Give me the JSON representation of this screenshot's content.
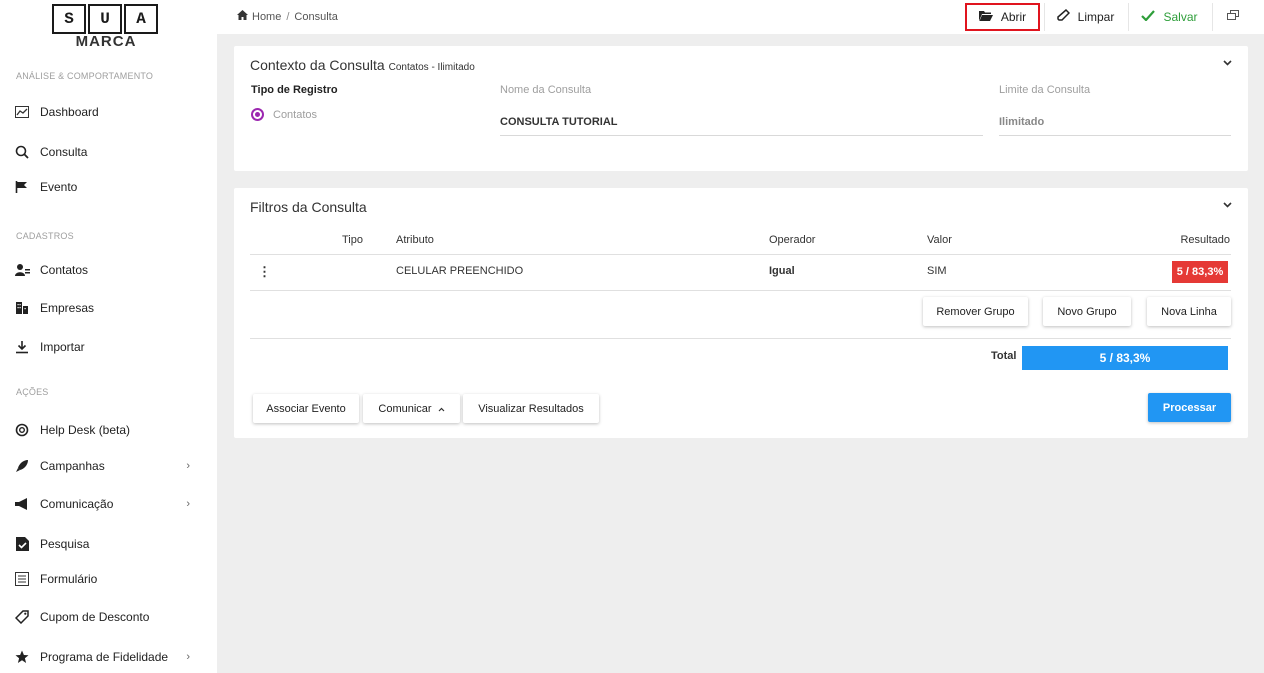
{
  "logo": {
    "letters": [
      "S",
      "U",
      "A"
    ],
    "subtitle": "MARCA"
  },
  "sidebar": {
    "sections": [
      {
        "title": "ANÁLISE & COMPORTAMENTO",
        "items": [
          {
            "label": "Dashboard",
            "icon": "dashboard-chart-icon"
          },
          {
            "label": "Consulta",
            "icon": "search-icon"
          },
          {
            "label": "Evento",
            "icon": "flag-icon"
          }
        ]
      },
      {
        "title": "CADASTROS",
        "items": [
          {
            "label": "Contatos",
            "icon": "contacts-icon"
          },
          {
            "label": "Empresas",
            "icon": "building-icon"
          },
          {
            "label": "Importar",
            "icon": "download-icon"
          }
        ]
      },
      {
        "title": "AÇÕES",
        "items": [
          {
            "label": "Help Desk (beta)",
            "icon": "lifebuoy-icon"
          },
          {
            "label": "Campanhas",
            "icon": "rocket-icon",
            "expandable": true
          },
          {
            "label": "Comunicação",
            "icon": "megaphone-icon",
            "expandable": true
          },
          {
            "label": "Pesquisa",
            "icon": "survey-check-icon"
          },
          {
            "label": "Formulário",
            "icon": "form-icon"
          },
          {
            "label": "Cupom de Desconto",
            "icon": "coupon-tag-icon"
          },
          {
            "label": "Programa de Fidelidade",
            "icon": "star-icon",
            "expandable": true
          }
        ]
      }
    ]
  },
  "breadcrumb": {
    "home": "Home",
    "separator": "/",
    "current": "Consulta"
  },
  "toolbar": {
    "abrir": "Abrir",
    "limpar": "Limpar",
    "salvar": "Salvar"
  },
  "contexto": {
    "title": "Contexto da Consulta",
    "subtitle": "Contatos - Ilimitado",
    "tipo_registro_label": "Tipo de Registro",
    "tipo_registro_option": "Contatos",
    "nome_label": "Nome da Consulta",
    "nome_value": "CONSULTA TUTORIAL",
    "limite_label": "Limite da Consulta",
    "limite_value": "Ilimitado"
  },
  "filtros": {
    "title": "Filtros da Consulta",
    "columns": {
      "tipo": "Tipo",
      "atributo": "Atributo",
      "operador": "Operador",
      "valor": "Valor",
      "resultado": "Resultado"
    },
    "rows": [
      {
        "tipo": "",
        "atributo": "CELULAR PREENCHIDO",
        "operador": "Igual",
        "valor": "SIM",
        "resultado": "5 / 83,3%"
      }
    ],
    "buttons": {
      "remover_grupo": "Remover Grupo",
      "novo_grupo": "Novo Grupo",
      "nova_linha": "Nova Linha"
    },
    "total_label": "Total",
    "total_value": "5 / 83,3%",
    "actions": {
      "associar_evento": "Associar Evento",
      "comunicar": "Comunicar",
      "visualizar": "Visualizar Resultados",
      "processar": "Processar"
    }
  },
  "colors": {
    "accent_blue": "#2196f3",
    "result_red": "#e53935",
    "radio_purple": "#9c27b0",
    "save_green": "#2e9e3a",
    "highlight_red": "#e0141e"
  }
}
